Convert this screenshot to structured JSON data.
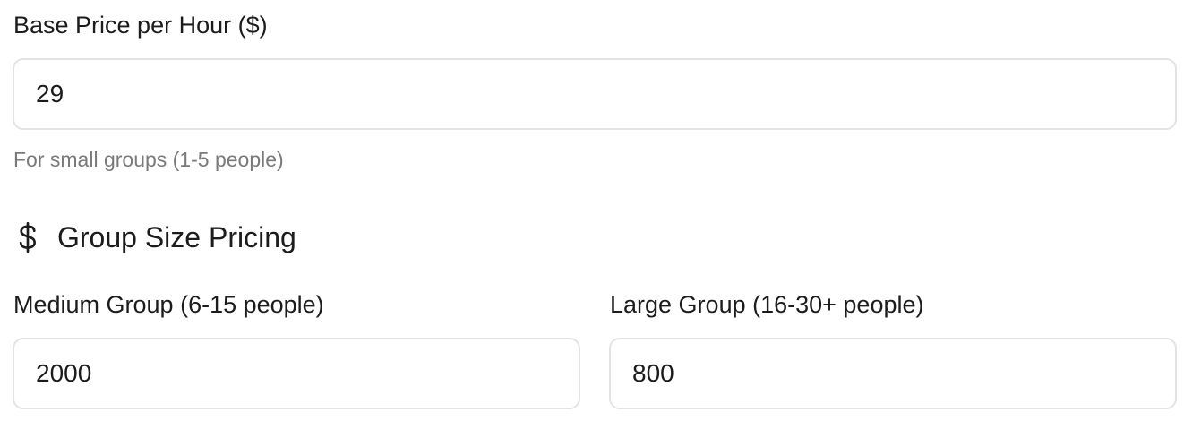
{
  "base_price": {
    "label": "Base Price per Hour ($)",
    "value": "29",
    "hint": "For small groups (1-5 people)"
  },
  "group_pricing": {
    "title": "Group Size Pricing",
    "icon": "dollar-icon",
    "medium": {
      "label": "Medium Group (6-15 people)",
      "value": "2000"
    },
    "large": {
      "label": "Large Group (16-30+ people)",
      "value": "800"
    }
  }
}
